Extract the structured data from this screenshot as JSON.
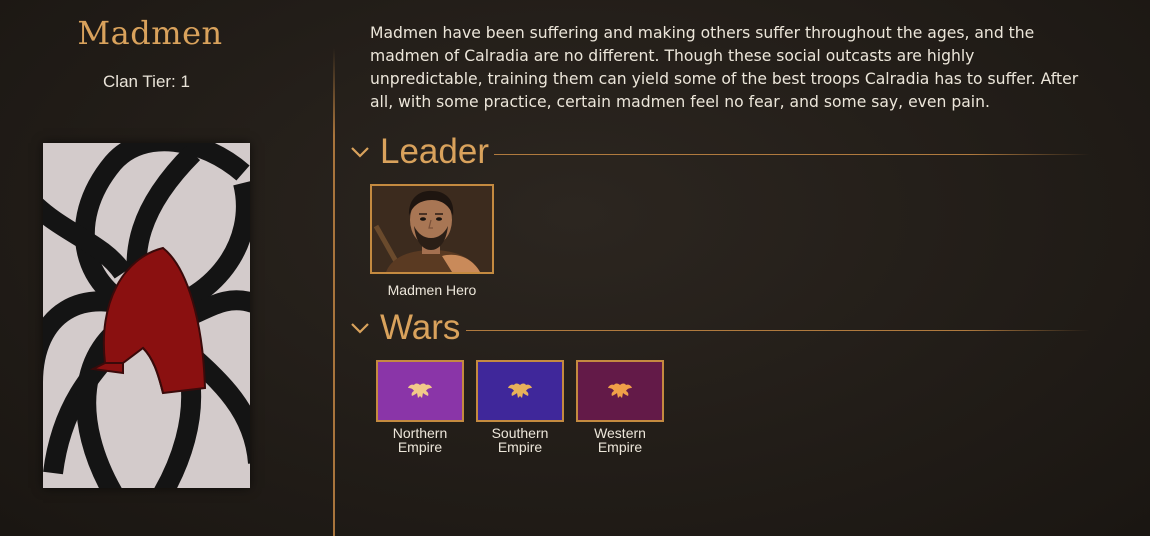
{
  "clan": {
    "name": "Madmen",
    "tier_label": "Clan Tier: 1",
    "banner_colors": {
      "background": "#d6cece",
      "stripes": "#141414",
      "helmet": "#8a1010"
    }
  },
  "description": "Madmen have been suffering and making others suffer throughout the ages, and the madmen of Calradia are no different. Though these social outcasts are highly unpredictable, training them can yield some of the best troops Calradia has to suffer. After all, with some practice, certain madmen feel no fear, and some say, even pain.",
  "sections": {
    "leader": {
      "title": "Leader",
      "hero": {
        "name": "Madmen Hero",
        "portrait": "bearded-man-portrait"
      }
    },
    "wars": {
      "title": "Wars",
      "factions": [
        {
          "name_line1": "Northern",
          "name_line2": "Empire",
          "color": "#8a35a8",
          "emblem": "double-headed-eagle-icon"
        },
        {
          "name_line1": "Southern",
          "name_line2": "Empire",
          "color": "#3f279a",
          "emblem": "double-headed-eagle-icon"
        },
        {
          "name_line1": "Western",
          "name_line2": "Empire",
          "color": "#631a48",
          "emblem": "double-headed-eagle-icon"
        }
      ]
    }
  },
  "colors": {
    "accent": "#d9a25c",
    "border": "#c48a40",
    "text": "#ece6da"
  }
}
